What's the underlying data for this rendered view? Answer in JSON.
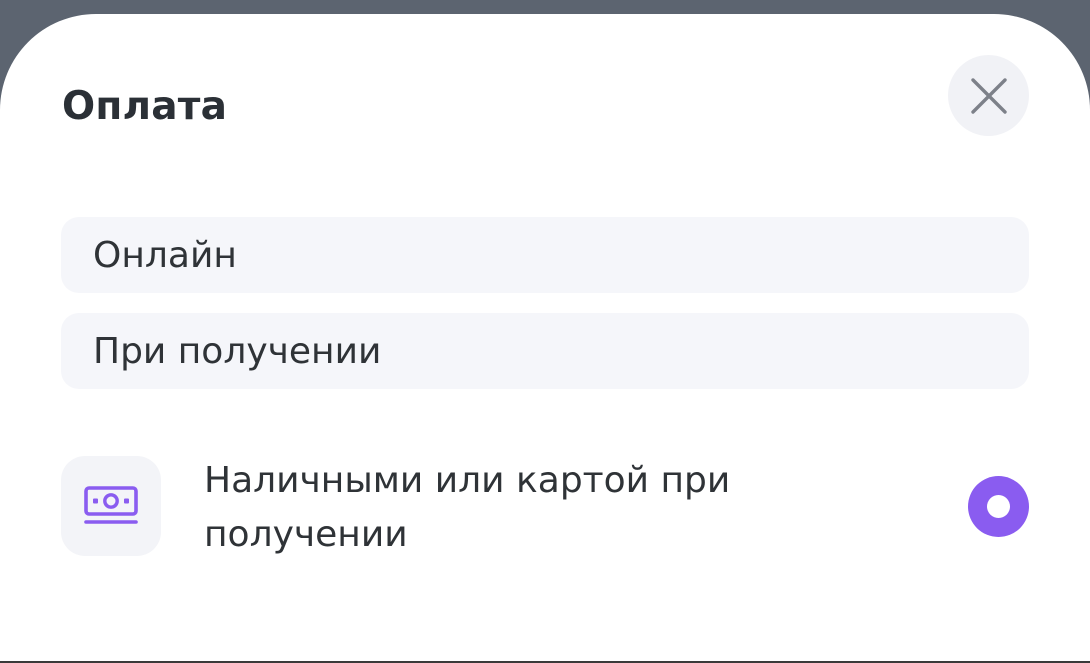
{
  "sheet": {
    "title": "Оплата",
    "close_icon": "close-icon"
  },
  "payment_groups": [
    {
      "label": "Онлайн"
    },
    {
      "label": "При получении"
    }
  ],
  "payment_option": {
    "icon": "cash-icon",
    "label": "Наличными или картой при получении",
    "selected": true
  },
  "colors": {
    "accent": "#8a5cf0",
    "text": "#2f3337",
    "title": "#2b3036",
    "pill_bg": "#f5f6fa",
    "backdrop": "#5c6470"
  }
}
